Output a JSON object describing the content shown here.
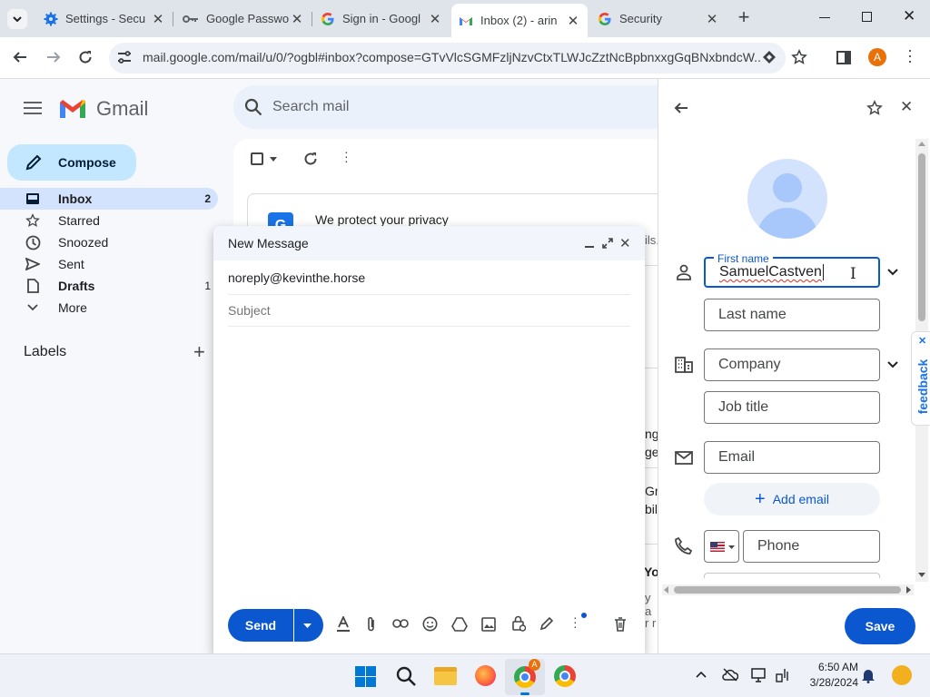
{
  "browser": {
    "tabs": [
      {
        "title": "Settings - Secu",
        "icon": "settings-gear-icon",
        "active": false
      },
      {
        "title": "Google Passwo",
        "icon": "key-icon",
        "active": false
      },
      {
        "title": "Sign in - Googl",
        "icon": "google-g-icon",
        "active": false
      },
      {
        "title": "Inbox (2) - arin",
        "icon": "gmail-icon",
        "active": true
      },
      {
        "title": "Security",
        "icon": "google-g-icon",
        "active": false
      }
    ],
    "url": "mail.google.com/mail/u/0/?ogbl#inbox?compose=GTvVlcSGMFzljNzvCtxTLWJcZztNcBpbnxxgGqBNxbndcW...",
    "profile_initial": "A",
    "profile_color": "#e8710a"
  },
  "gmail": {
    "app_name": "Gmail",
    "search_placeholder": "Search mail",
    "compose_label": "Compose",
    "nav": [
      {
        "label": "Inbox",
        "count": "2"
      },
      {
        "label": "Starred",
        "count": ""
      },
      {
        "label": "Snoozed",
        "count": ""
      },
      {
        "label": "Sent",
        "count": ""
      },
      {
        "label": "Drafts",
        "count": "1"
      },
      {
        "label": "More",
        "count": ""
      }
    ],
    "labels_heading": "Labels",
    "promo_title": "We protect your privacy",
    "promo_fragment": "ils.",
    "clipped_fragments": [
      "ng",
      "ge",
      "Gr",
      "bile",
      "Yo",
      "y a",
      "r r"
    ]
  },
  "compose": {
    "title": "New Message",
    "to": "noreply@kevinthe.horse",
    "subject_placeholder": "Subject",
    "send_label": "Send"
  },
  "contact": {
    "first_name_label": "First name",
    "first_name_value": "SamuelCastven",
    "last_name_placeholder": "Last name",
    "company_placeholder": "Company",
    "job_title_placeholder": "Job title",
    "email_placeholder": "Email",
    "add_email_label": "Add email",
    "phone_placeholder": "Phone",
    "save_label": "Save",
    "feedback_label": "feedback"
  },
  "taskbar": {
    "time": "6:50 AM",
    "date": "3/28/2024",
    "chrome_badge": "A"
  },
  "colors": {
    "accent_blue": "#0b57d0",
    "inbox_highlight": "#d3e3fd",
    "compose_button": "#c2e7ff"
  }
}
